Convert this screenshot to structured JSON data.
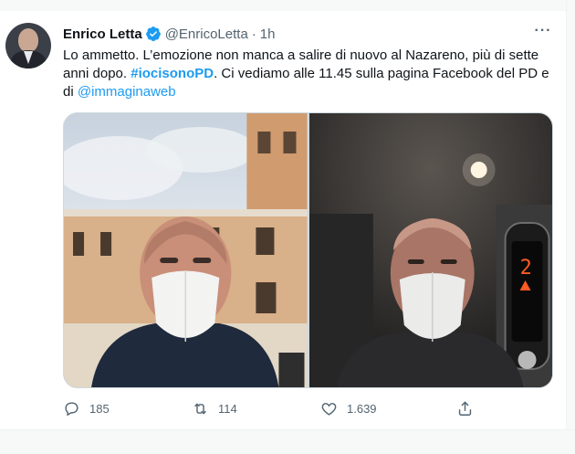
{
  "tweet": {
    "author_name": "Enrico Letta",
    "author_handle": "@EnricoLetta",
    "separator": "·",
    "time": "1h",
    "text_part1": "Lo ammetto. L’emozione non manca a salire di nuovo al Nazareno, più di sette anni dopo. ",
    "hashtag": "#iocisonoPD",
    "text_part2": ". Ci vediamo alle 11.45 sulla pagina Facebook del PD e di ",
    "mention": "@immaginaweb",
    "more_label": "···"
  },
  "actions": {
    "reply_count": "185",
    "retweet_count": "114",
    "like_count": "1.639"
  },
  "colors": {
    "accent": "#1d9bf0",
    "secondary_text": "#536471",
    "primary_text": "#0f1419"
  },
  "icons": [
    "verified-badge-icon",
    "more-options-icon",
    "reply-icon",
    "retweet-icon",
    "like-icon",
    "share-icon"
  ]
}
